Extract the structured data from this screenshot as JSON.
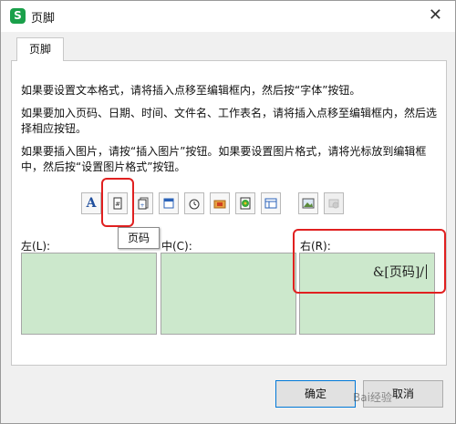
{
  "window": {
    "title": "页脚",
    "app_icon": "S",
    "close_glyph": "✕"
  },
  "tab": {
    "label": "页脚"
  },
  "instructions": [
    "如果要设置文本格式，请将插入点移至编辑框内，然后按“字体”按钮。",
    "如果要加入页码、日期、时间、文件名、工作表名，请将插入点移至编辑框内，然后选择相应按钮。",
    "如果要插入图片，请按“插入图片”按钮。如果要设置图片格式，请将光标放到编辑框中，然后按“设置图片格式”按钮。"
  ],
  "toolbar": {
    "font_glyph": "A",
    "tooltip": "页码"
  },
  "sections": {
    "left_label": "左(L):",
    "center_label": "中(C):",
    "right_label": "右(R):",
    "right_value": "&[页码]/"
  },
  "buttons": {
    "ok": "确定",
    "cancel": "取消"
  },
  "watermark": "Bai经验",
  "colors": {
    "section_bg": "#cce8cc",
    "highlight": "#e02020",
    "app_icon": "#1aa04a"
  }
}
